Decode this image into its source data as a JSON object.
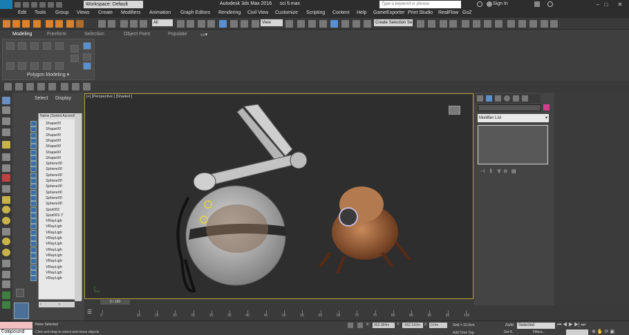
{
  "title_bar": {
    "workspace": "Workspace: Default",
    "app_title": "Autodesk 3ds Max 2016",
    "file_name": "sci fi.max",
    "search_placeholder": "Type a keyword or phrase",
    "sign_in": "Sign In"
  },
  "menu": [
    "Edit",
    "Tools",
    "Group",
    "Views",
    "Create",
    "Modifiers",
    "Animation",
    "Graph Editors",
    "Rendering",
    "Civil View",
    "Customize",
    "Scripting",
    "Content",
    "Help",
    "GameExporter",
    "Print Studio",
    "RealFlow",
    "GoZ"
  ],
  "toolbar": {
    "selection_filter": "All",
    "reference_coord": "View",
    "named_selection": "Create Selection Se"
  },
  "ribbon": {
    "tabs": [
      "Modeling",
      "Freeform",
      "Selection",
      "Object Paint",
      "Populate"
    ],
    "active_tab": "Modeling",
    "panel_label": "Polygon Modeling"
  },
  "explorer": {
    "tabs": [
      "Select",
      "Display"
    ],
    "column_header": "Name (Sorted Ascending)",
    "items": [
      "Shape00",
      "Shape00",
      "Shape00",
      "Shape00",
      "Shape00",
      "Shape00",
      "Shape00",
      "Sphere00",
      "Sphere00",
      "Sphere00",
      "Sphere00",
      "Sphere00",
      "Sphere00",
      "Sphere00",
      "Sphere00",
      "Spot001",
      "Spot001.T",
      "VRayLigh",
      "VRayLigh",
      "VRayLigh",
      "VRayLigh",
      "VRayLigh",
      "VRayLigh",
      "VRayLigh",
      "VRayLigh",
      "VRayLigh",
      "VRayLigh",
      "VRayLigh"
    ]
  },
  "viewport": {
    "label": "[+] [Perspective ] [Shaded ]"
  },
  "right_panel": {
    "modifier_list": "Modifier List"
  },
  "timeline": {
    "frame_display": "0 / 100",
    "ticks": [
      "0",
      "10",
      "15",
      "20",
      "25",
      "30",
      "35",
      "40",
      "45",
      "50",
      "55",
      "60",
      "65",
      "70",
      "75",
      "80",
      "85",
      "90",
      "95",
      "100"
    ]
  },
  "status": {
    "maxscript": "Compound ",
    "selection": "None Selected",
    "hint": "Click and drag to select and move objects",
    "x_value": "452.384m",
    "y_value": "-562.142m",
    "z_value": "0.0m",
    "grid": "Grid = 10.0cm",
    "add_time_tag": "Add Time Tag",
    "auto_key": "Auto",
    "key_mode": "Selected",
    "set_key": "Set K.",
    "filters": "Filters..."
  },
  "colors": {
    "viewport_border": "#b9a43a",
    "object_color_swatch": "#d63d8e"
  }
}
